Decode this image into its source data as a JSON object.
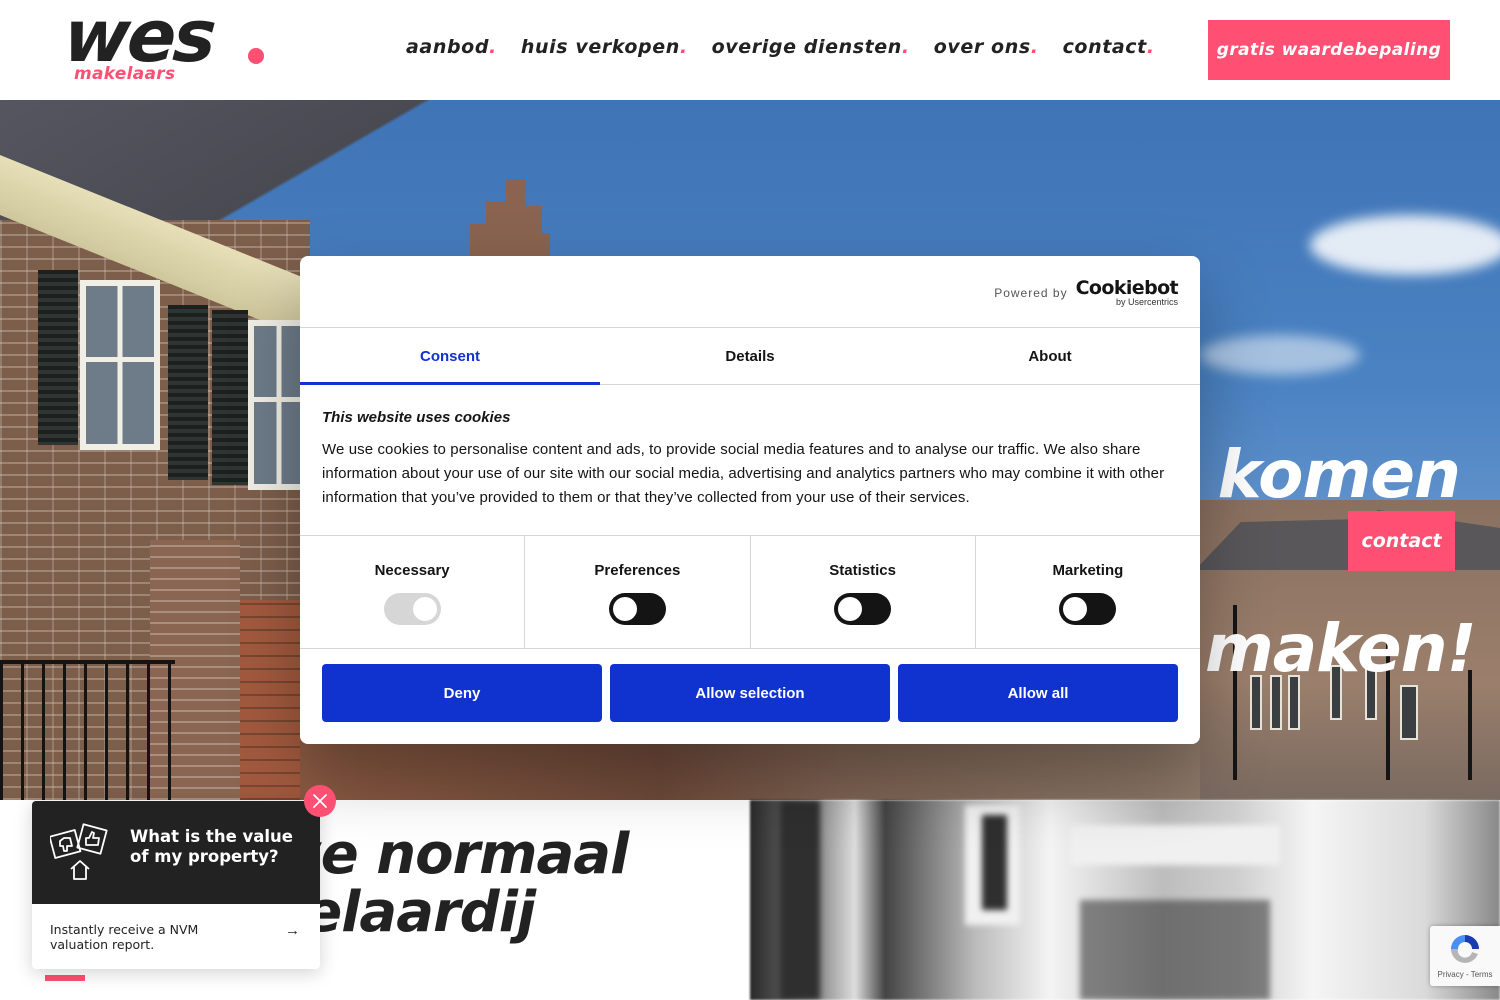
{
  "header": {
    "logo": {
      "main": "wes",
      "sub": "makelaars"
    },
    "nav": [
      {
        "label": "aanbod"
      },
      {
        "label": "huis verkopen"
      },
      {
        "label": "overige diensten"
      },
      {
        "label": "over ons"
      },
      {
        "label": "contact"
      }
    ],
    "nav_dot": ".",
    "cta_label": "gratis waardebepaling"
  },
  "hero": {
    "title_line1": "komen",
    "title_line2": "maken!",
    "cta_label": "contact"
  },
  "lower": {
    "title_line1": "we normaal",
    "title_line2": "kelaardij"
  },
  "cookie_dialog": {
    "powered_by": "Powered by",
    "brand": "Cookiebot",
    "brand_sub": "by Usercentrics",
    "tabs": [
      {
        "label": "Consent",
        "active": true
      },
      {
        "label": "Details",
        "active": false
      },
      {
        "label": "About",
        "active": false
      }
    ],
    "heading": "This website uses cookies",
    "body": "We use cookies to personalise content and ads, to provide social media features and to analyse our traffic. We also share information about your use of our site with our social media, advertising and analytics partners who may combine it with other information that you’ve provided to them or that they’ve collected from your use of their services.",
    "categories": [
      {
        "label": "Necessary",
        "enabled": true,
        "locked": true
      },
      {
        "label": "Preferences",
        "enabled": false,
        "locked": false
      },
      {
        "label": "Statistics",
        "enabled": false,
        "locked": false
      },
      {
        "label": "Marketing",
        "enabled": false,
        "locked": false
      }
    ],
    "buttons": {
      "deny": "Deny",
      "allow_selection": "Allow selection",
      "allow_all": "Allow all"
    }
  },
  "valuation_popup": {
    "title": "What is the value of my property?",
    "text": "Instantly receive a NVM valuation report.",
    "arrow_icon": "→"
  },
  "recaptcha": {
    "text": "Privacy - Terms"
  },
  "colors": {
    "brand_pink": "#ff4f72",
    "cookiebot_blue": "#1032cf",
    "text_dark": "#222222"
  }
}
